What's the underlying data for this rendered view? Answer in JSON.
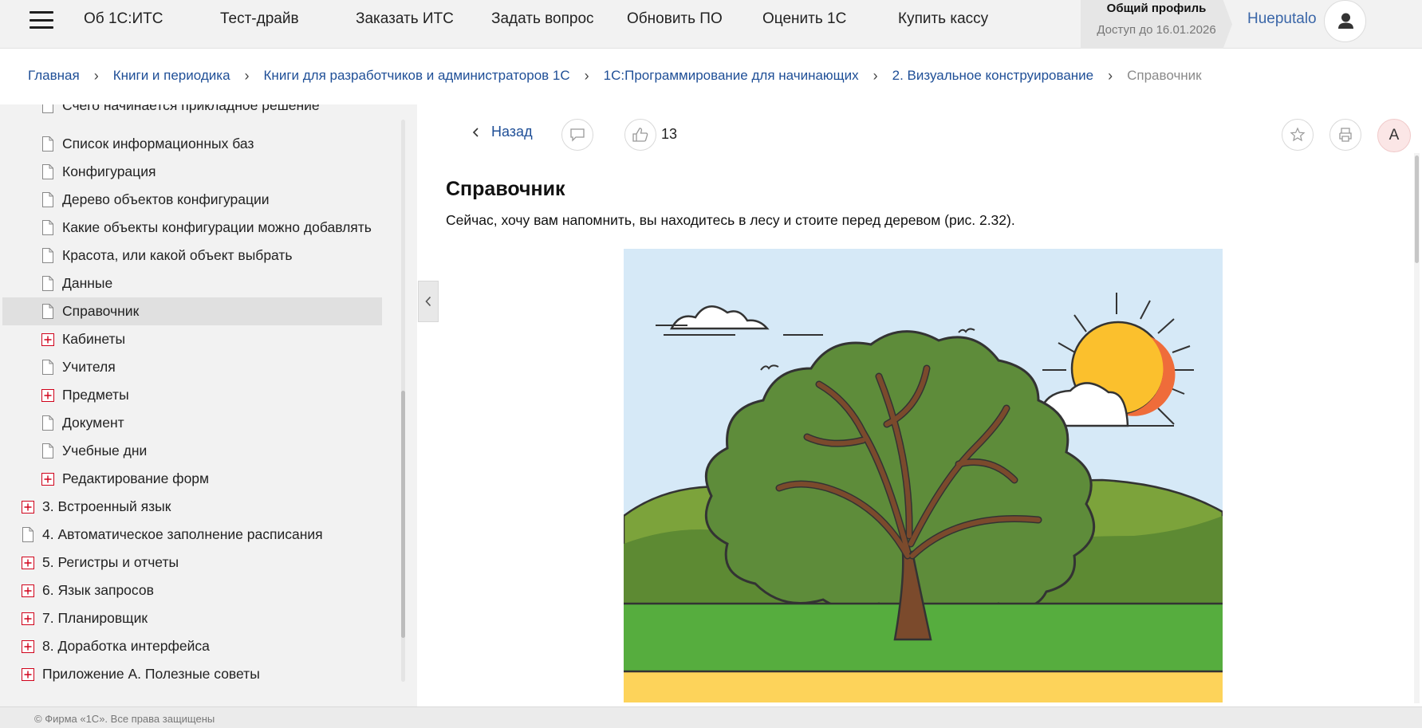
{
  "topnav": {
    "items": [
      "Об 1С:ИТС",
      "Тест-драйв",
      "Заказать ИТС",
      "Задать вопрос",
      "Обновить ПО",
      "Оценить 1С",
      "Купить кассу"
    ],
    "profile_title": "Общий профиль",
    "profile_access": "Доступ до 16.01.2026",
    "username": "Hueputalo"
  },
  "breadcrumbs": [
    "Главная",
    "Книги и периодика",
    "Книги для разработчиков и администраторов 1С",
    "1С:Программирование для начинающих",
    "2. Визуальное конструирование",
    "Справочник"
  ],
  "sidebar": {
    "partial_item": "Счего начинается прикладное решение",
    "items": [
      {
        "label": "Список информационных баз",
        "type": "doc",
        "selected": false
      },
      {
        "label": "Конфигурация",
        "type": "doc",
        "selected": false
      },
      {
        "label": "Дерево объектов конфигурации",
        "type": "doc",
        "selected": false
      },
      {
        "label": "Какие объекты конфигурации можно добавлять",
        "type": "doc",
        "selected": false
      },
      {
        "label": "Красота, или какой объект выбрать",
        "type": "doc",
        "selected": false
      },
      {
        "label": "Данные",
        "type": "doc",
        "selected": false
      },
      {
        "label": "Справочник",
        "type": "doc",
        "selected": true
      },
      {
        "label": "Кабинеты",
        "type": "plus",
        "selected": false
      },
      {
        "label": "Учителя",
        "type": "doc",
        "selected": false
      },
      {
        "label": "Предметы",
        "type": "plus",
        "selected": false
      },
      {
        "label": "Документ",
        "type": "doc",
        "selected": false
      },
      {
        "label": "Учебные дни",
        "type": "doc",
        "selected": false
      },
      {
        "label": "Редактирование форм",
        "type": "plus",
        "selected": false
      },
      {
        "label": "3. Встроенный язык",
        "type": "plus",
        "selected": false
      },
      {
        "label": "4. Автоматическое заполнение расписания",
        "type": "doc",
        "selected": false
      },
      {
        "label": "5. Регистры и отчеты",
        "type": "plus",
        "selected": false
      },
      {
        "label": "6. Язык запросов",
        "type": "plus",
        "selected": false
      },
      {
        "label": "7. Планировщик",
        "type": "plus",
        "selected": false
      },
      {
        "label": "8. Доработка интерфейса",
        "type": "plus",
        "selected": false
      },
      {
        "label": "Приложение А. Полезные советы",
        "type": "plus",
        "selected": false
      }
    ]
  },
  "toolbar": {
    "back_label": "Назад",
    "like_count": "13",
    "font_label": "A"
  },
  "article": {
    "title": "Справочник",
    "text": "Сейчас, хочу вам напомнить, вы находитесь в лесу и стоите перед деревом (рис. 2.32)."
  },
  "footer": {
    "copyright": "© Фирма «1С». Все права защищены"
  },
  "colors": {
    "link": "#1f4f97",
    "plus_icon": "#d0021b",
    "sidebar_bg": "#f2f2f2"
  }
}
